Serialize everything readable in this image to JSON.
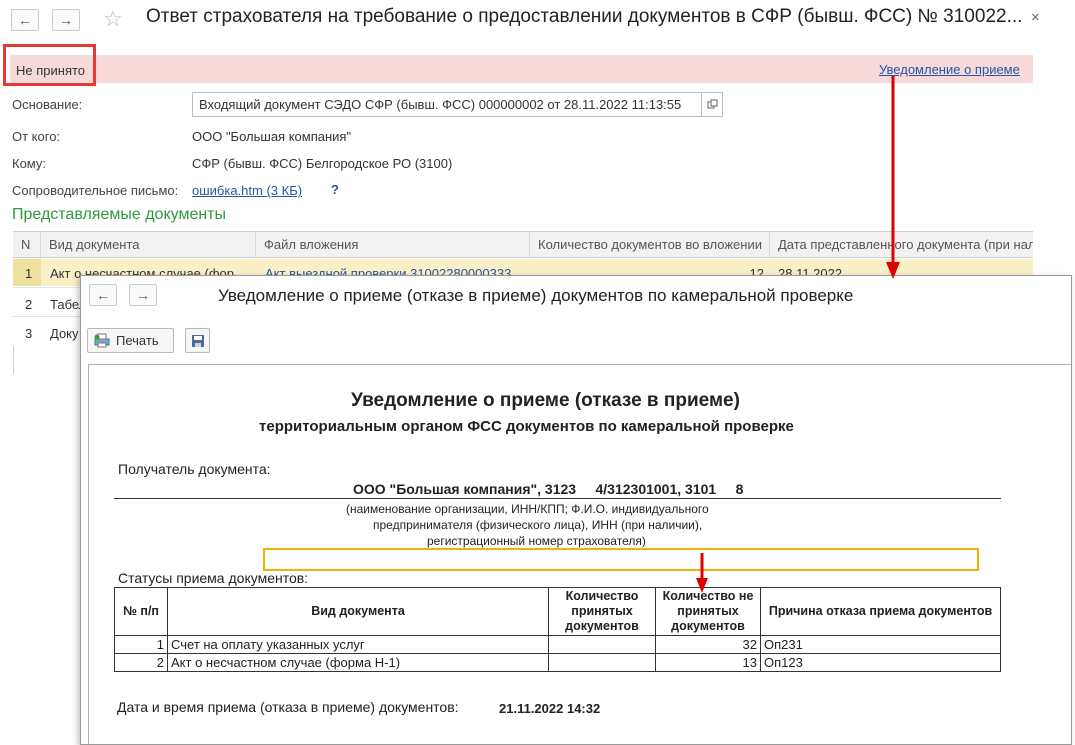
{
  "main_window": {
    "back": "←",
    "forward": "→",
    "star": "☆",
    "title": "Ответ страхователя на требование о предоставлении документов в СФР (бывш. ФСС) № 310022...",
    "close": "×",
    "status": "Не принято",
    "notice_link": "Уведомление о приеме",
    "fields": {
      "basis_label": "Основание:",
      "basis_value": "Входящий документ СЭДО СФР (бывш. ФСС) 000000002 от 28.11.2022 11:13:55",
      "from_label": "От кого:",
      "from_value": "ООО \"Большая компания\"",
      "to_label": "Кому:",
      "to_value": "СФР (бывш. ФСС) Белгородское РО (3100)",
      "cover_label": "Сопроводительное письмо:",
      "cover_value": "ошибка.htm (3 КБ)",
      "help": "?"
    },
    "section_title": "Представляемые документы",
    "grid": {
      "headers": [
        "N",
        "Вид документа",
        "Файл вложения",
        "Количество документов во вложении",
        "Дата представленного документа (при нал"
      ],
      "rows": [
        {
          "n": "1",
          "type": "Акт о несчастном случае (фор",
          "file": "Акт выездной проверки 31002280000333",
          "count": "12",
          "date": "28.11.2022"
        },
        {
          "n": "2",
          "type": "Табел",
          "file": "",
          "count": "",
          "date": ""
        },
        {
          "n": "3",
          "type": "Доку",
          "file": "",
          "count": "",
          "date": ""
        }
      ]
    }
  },
  "popup": {
    "back": "←",
    "forward": "→",
    "title": "Уведомление о приеме (отказе в приеме) документов по камеральной проверке",
    "print_button": "Печать",
    "doc": {
      "heading": "Уведомление о приеме (отказе в приеме)",
      "subheading": "территориальным органом ФСС документов по камеральной проверке",
      "recipient_label": "Получатель документа:",
      "recipient_value": "ООО \"Большая компания\", 3123     4/312301001, 3101     8",
      "recipient_note_1": "(наименование организации, ИНН/КПП; Ф.И.О. индивидуального",
      "recipient_note_2": "предпринимателя (физического лица), ИНН (при наличии),",
      "recipient_note_3": "регистрационный номер страхователя)",
      "statuses_label": "Статусы приема документов:",
      "table": {
        "headers": [
          "№ п/п",
          "Вид документа",
          "Количество принятых документов",
          "Количество не принятых документов",
          "Причина отказа приема документов"
        ],
        "rows": [
          {
            "n": "1",
            "type": "Счет на оплату указанных услуг",
            "accepted": "",
            "rejected": "32",
            "reason": "Оп231"
          },
          {
            "n": "2",
            "type": "Акт о несчастном случае (форма Н-1)",
            "accepted": "",
            "rejected": "13",
            "reason": "Оп123"
          }
        ]
      },
      "datetime_label": "Дата и время приема (отказа в приеме) документов:",
      "datetime_value": "21.11.2022 14:32"
    }
  },
  "colors": {
    "banner": "#f7d9d9",
    "highlight_box": "#e53935",
    "arrow": "#e00000",
    "section_title": "#2e9a3c",
    "link": "#2556a6",
    "selected_row": "#faf0c8",
    "yellow_frame": "#f0b400"
  }
}
